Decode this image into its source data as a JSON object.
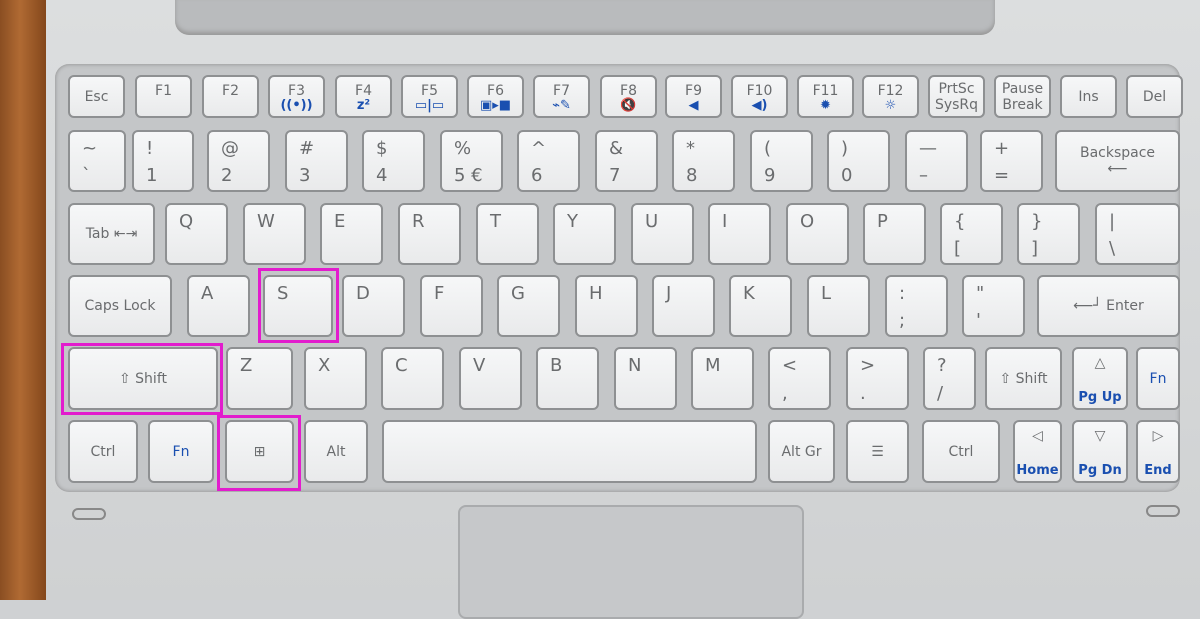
{
  "rows": [
    [
      {
        "c": "Esc"
      },
      {
        "f": "F1"
      },
      {
        "f": "F2"
      },
      {
        "f": "F3",
        "i": "((•))"
      },
      {
        "f": "F4",
        "i": "z²"
      },
      {
        "f": "F5",
        "i": "▭|▭"
      },
      {
        "f": "F6",
        "i": "▣▸■"
      },
      {
        "f": "F7",
        "i": "⌁✎"
      },
      {
        "f": "F8",
        "i": "🔇"
      },
      {
        "f": "F9",
        "i": "◀"
      },
      {
        "f": "F10",
        "i": "◀)"
      },
      {
        "f": "F11",
        "i": "✹"
      },
      {
        "f": "F12",
        "i": "☼"
      },
      {
        "c": "PrtSc\nSysRq"
      },
      {
        "c": "Pause\nBreak"
      },
      {
        "c": "Ins"
      },
      {
        "c": "Del"
      }
    ],
    [
      {
        "t": "~",
        "b": "`"
      },
      {
        "t": "!",
        "b": "1"
      },
      {
        "t": "@",
        "b": "2"
      },
      {
        "t": "#",
        "b": "3"
      },
      {
        "t": "$",
        "b": "4"
      },
      {
        "t": "%",
        "b": "5      €"
      },
      {
        "t": "^",
        "b": "6"
      },
      {
        "t": "&",
        "b": "7"
      },
      {
        "t": "*",
        "b": "8"
      },
      {
        "t": "(",
        "b": "9"
      },
      {
        "t": ")",
        "b": "0"
      },
      {
        "t": "—",
        "b": "–"
      },
      {
        "t": "+",
        "b": "="
      },
      {
        "c": "Backspace\n⟵"
      }
    ],
    [
      {
        "c": "Tab ⇤⇥"
      },
      {
        "t": "Q"
      },
      {
        "t": "W"
      },
      {
        "t": "E"
      },
      {
        "t": "R"
      },
      {
        "t": "T"
      },
      {
        "t": "Y"
      },
      {
        "t": "U"
      },
      {
        "t": "I"
      },
      {
        "t": "O"
      },
      {
        "t": "P"
      },
      {
        "t": "{",
        "b": "["
      },
      {
        "t": "}",
        "b": "]"
      },
      {
        "t": "|",
        "b": "\\"
      }
    ],
    [
      {
        "c": "Caps Lock"
      },
      {
        "t": "A"
      },
      {
        "t": "S"
      },
      {
        "t": "D"
      },
      {
        "t": "F"
      },
      {
        "t": "G"
      },
      {
        "t": "H"
      },
      {
        "t": "J"
      },
      {
        "t": "K"
      },
      {
        "t": "L"
      },
      {
        "t": ":",
        "b": ";"
      },
      {
        "t": "\"",
        "b": "'"
      },
      {
        "c": "⟵┘ Enter"
      }
    ],
    [
      {
        "c": "⇧ Shift"
      },
      {
        "t": "Z"
      },
      {
        "t": "X"
      },
      {
        "t": "C"
      },
      {
        "t": "V"
      },
      {
        "t": "B"
      },
      {
        "t": "N"
      },
      {
        "t": "M"
      },
      {
        "t": "<",
        "b": ","
      },
      {
        "t": ">",
        "b": "."
      },
      {
        "t": "?",
        "b": "/"
      },
      {
        "c": "⇧ Shift"
      },
      {
        "f": "△",
        "i": "Pg Up"
      },
      {
        "c": "Fn",
        "blue": true
      }
    ],
    [
      {
        "c": "Ctrl"
      },
      {
        "c": "Fn",
        "blue": true
      },
      {
        "c": "⊞"
      },
      {
        "c": "Alt"
      },
      {
        "c": ""
      },
      {
        "c": "Alt Gr"
      },
      {
        "c": "☰"
      },
      {
        "c": "Ctrl"
      },
      {
        "f": "◁",
        "i": "Home"
      },
      {
        "f": "▽",
        "i": "Pg Dn"
      },
      {
        "f": "▷",
        "i": "End"
      }
    ]
  ],
  "highlighted_keys": [
    "S",
    "Shift",
    "Windows"
  ],
  "highlight_color": "#e21ccd"
}
